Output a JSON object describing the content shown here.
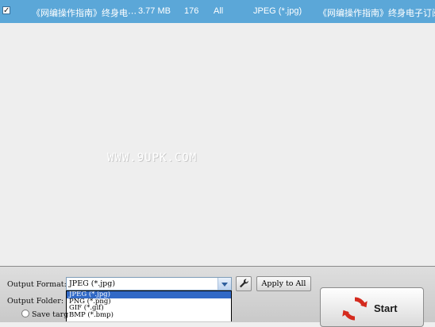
{
  "file_row": {
    "checked_glyph": "✓",
    "name": "《网编操作指南》终身电⋯",
    "size": "3.77 MB",
    "pages": "176",
    "range": "All",
    "format": "JPEG (*.jpg)",
    "output_name": "《网编操作指南》终身电子订阅版"
  },
  "watermark": "WWW.9UPK.COM",
  "controls": {
    "output_format_label": "Output Format:",
    "output_folder_label": "Output Folder:",
    "selected_format": "JPEG (*.jpg)",
    "format_options": [
      "JPEG (*.jpg)",
      "PNG (*.png)",
      "GIF (*.gif)",
      "BMP (*.bmp)"
    ],
    "apply_label": "Apply to All",
    "save_target_label": "Save targ",
    "start_label": "Start"
  },
  "icons": {
    "settings": "wrench-icon",
    "start": "refresh-arrows-icon",
    "dropdown": "chevron-down-icon"
  },
  "colors": {
    "row_selected": "#5ba7d8",
    "option_highlight": "#3169c6",
    "start_icon": "#d42a1e"
  }
}
